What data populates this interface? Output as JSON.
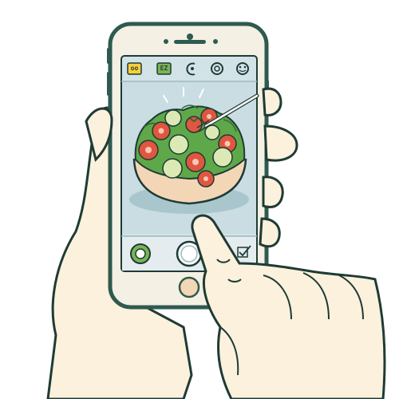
{
  "camera_top_bar": {
    "items": [
      {
        "icon": "hdr-badge-icon",
        "label": "oo",
        "color": "#f4cf3a"
      },
      {
        "icon": "flash-badge-icon",
        "label": "EZ",
        "color": "#79b553"
      },
      {
        "icon": "timer-icon"
      },
      {
        "icon": "live-photo-icon"
      },
      {
        "icon": "filter-icon"
      }
    ]
  },
  "viewfinder": {
    "subject": "salad-bowl",
    "colors": {
      "screen": "#d2e3e8",
      "bowl": "#f3d6b6",
      "lettuce": "#5fa84a",
      "tomato": "#e0563f",
      "cucumber": "#dbe9b5"
    }
  },
  "camera_bottom_bar": {
    "items": [
      {
        "icon": "gallery-thumbnail-icon"
      },
      {
        "icon": "shutter-button-icon"
      },
      {
        "icon": "edit-checkbox-icon"
      }
    ]
  },
  "colors": {
    "phone_frame": "#2f5a4f",
    "phone_body": "#f4f0e4",
    "skin": "#fbf1dd",
    "outline": "#1f3b35"
  }
}
